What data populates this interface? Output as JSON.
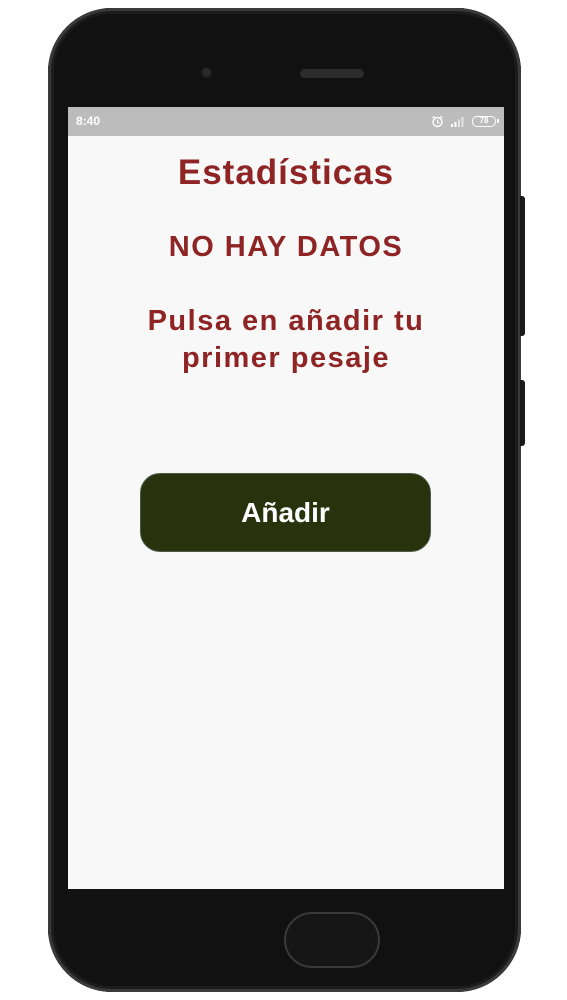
{
  "status_bar": {
    "time": "8:40",
    "battery": "78"
  },
  "screen": {
    "title": "Estadísticas",
    "no_data": "NO HAY DATOS",
    "hint": "Pulsa en añadir tu primer pesaje",
    "add_button": "Añadir"
  },
  "colors": {
    "text_accent": "#8e2424",
    "button_bg": "#28330e",
    "status_bar_bg": "#bcbcbc"
  }
}
